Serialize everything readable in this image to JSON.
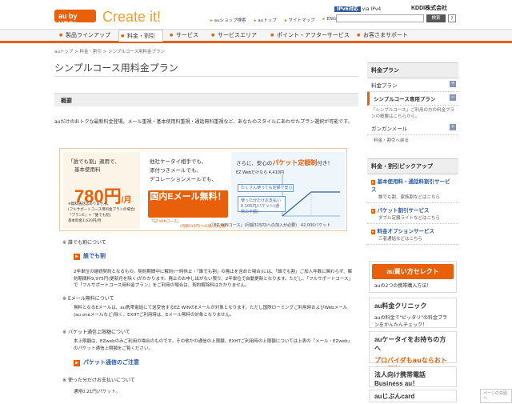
{
  "header": {
    "logo": "au by KDDI",
    "tagline": "Create it!",
    "ipv6_badge": "IPv6対応",
    "ipv6_via": "via IPv4",
    "company": "KDDI株式会社",
    "toplinks": [
      "auショップ検索",
      "auトップ",
      "サイトマップ",
      "ENGLISH"
    ],
    "search_placeholder": "",
    "search_button": "検索",
    "help_button": "?"
  },
  "nav": {
    "items": [
      "製品ラインアップ",
      "料金・割引",
      "サービス",
      "サービスエリア",
      "ポイント・アフターサービス",
      "お客さまサポート"
    ],
    "active": "料金・割引"
  },
  "breadcrumb": "auトップ > 料金・割引 > シンプルコース用料金プラン",
  "page_title": "シンプルコース用料金プラン",
  "section_header": "概要",
  "intro": "auだけのおトクな最新料金登場。メール重視・基本使用料重視・通話無料重視など、あなたのスタイルにあわせたプラン選択が可能です。",
  "banner": {
    "left_line1": "「誰でも割」適用で、",
    "left_line2": "基本使用料",
    "price": "780円",
    "price_unit": "/月",
    "left_note1": "※無料通話はありません。",
    "left_note2": "(フルサポートコース用料金プランの場合)",
    "left_note3": "「プランE」+「誰でも割」",
    "left_note4": "基本料金1,620円/月",
    "mid_line1": "他社ケータイ相手でも、",
    "mid_line2": "添付つきメールでも、",
    "mid_line3": "デコレーションメールでも、",
    "mid_big": "国内Eメール無料！",
    "mid_tag1": "「EZ WINコース」",
    "mid_tag2": "(月額315円)への加入が必要",
    "right_line1": "さらに、安心の",
    "right_highlight": "パケット定額制",
    "right_line1b": "付き！",
    "right_ez": "EZ Webだけなら 4,410円",
    "right_pill1": "たくさん使っても定額で安心",
    "right_pill2a": "使った分だけお支払い",
    "right_pill2b": "0.105円/パケット",
    "right_pill2c": "(通常の半額)",
    "right_note": "(「EZ WINコース」(月額315円)への加入が必要)　42,000パケット"
  },
  "sections": [
    {
      "head": "誰でも割について",
      "link": "誰でも割",
      "body": "2年単位の継続契約となるもの。契約期間中に解約(一時休止・「誰でも割」の廃止を含めた場合)には、「誰でも割」ご加入年数に関わらず、解約期間料9,975円(更新月を除く)がかかります。廃止のお申し出がない限り、2年単位で自動更新となります。ただし、「フルサポートコース」で「フルサポートコース用料金プラン」をご利用の場合は、契約解除料はかかりません。"
    },
    {
      "head": "Eメール無料について",
      "link": "",
      "body": "無料となるEメールは、au携帯電話にて送受信するEZ WINのEメールが対象となります。ただし国際ローミングご利用時およびWebメール(au oneメールなど)除く。EXHTご利用時は、Eメール無料の対象となりません。"
    },
    {
      "head": "パケット通信上限額について",
      "link": "パケット通信のご注意",
      "body": "本上限額は、EZwebのみご利用の場合のものです。その他かの通信の上限額、EXHTご利用時の上限額については上表の「メール・EZweb」のパケット通信上限額をご覧ください。"
    },
    {
      "head": "使った分だけお支払いについて",
      "link": "",
      "body": "通常0.21円/パケット。"
    }
  ],
  "sidebar": {
    "header1": "料金プラン",
    "items1": [
      "料金プラン",
      "シンプルコース専用プラン"
    ],
    "selected_desc": "「シンプルコース」ご利用の方の料金プランの概要はこちらから。",
    "item_gangan": "ガンガンメール",
    "back": "料金・割引へ戻る",
    "header2": "料金・割引ピックアップ",
    "pickups": [
      {
        "title": "基本使用料・通話料割引サービス",
        "desc": "誰でも割、家族割などはこちら"
      },
      {
        "title": "パケット割引サービス",
        "desc": "ダブル定額ライトなどはこちら"
      },
      {
        "title": "料金オプションサービス",
        "desc": "三者通話などはこちら"
      }
    ],
    "ads": [
      {
        "title": "au買い方セレクト",
        "desc": "auの2つの携帯購入方法！"
      },
      {
        "title": "au料金クリニック",
        "desc": "auの料金で\"ピッタリ\"の料金プランをかんたんチェック！"
      },
      {
        "title": "auケータイをお持ちの方へ",
        "desc": "プロバイダもauならおトクで便利"
      },
      {
        "title": "法人向け携帯電話 Business au！",
        "desc": ""
      },
      {
        "title": "auじぶんcard",
        "desc": ""
      }
    ]
  },
  "feedback": "ページの先頭へ"
}
